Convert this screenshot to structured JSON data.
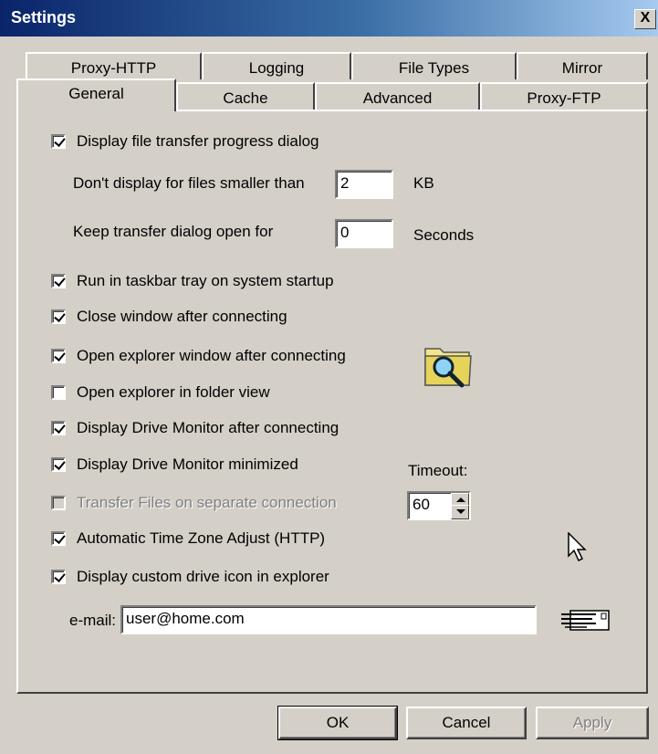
{
  "window": {
    "title": "Settings",
    "close_label": "X"
  },
  "tabs": {
    "back_row": [
      "Proxy-HTTP",
      "Logging",
      "File Types",
      "Mirror"
    ],
    "front_row": [
      "General",
      "Cache",
      "Advanced",
      "Proxy-FTP"
    ],
    "active": "General"
  },
  "general": {
    "display_progress": {
      "label": "Display file transfer progress dialog",
      "checked": true
    },
    "dont_display_label": "Don't display for files smaller than",
    "dont_display_value": "2",
    "dont_display_unit": "KB",
    "keep_open_label": "Keep transfer dialog open for",
    "keep_open_value": "0",
    "keep_open_unit": "Seconds",
    "run_tray": {
      "label": "Run in taskbar tray on system startup",
      "checked": true
    },
    "close_window": {
      "label": "Close window after connecting",
      "checked": true
    },
    "open_explorer": {
      "label": "Open explorer window after connecting",
      "checked": true
    },
    "folder_view": {
      "label": "Open explorer in folder view",
      "checked": false
    },
    "drive_monitor": {
      "label": "Display Drive Monitor after connecting",
      "checked": true
    },
    "drive_monitor_min": {
      "label": "Display Drive Monitor minimized",
      "checked": true
    },
    "separate_conn": {
      "label": "Transfer Files on separate connection",
      "checked": false,
      "disabled": true
    },
    "timezone": {
      "label": "Automatic Time Zone Adjust (HTTP)",
      "checked": true
    },
    "custom_icon": {
      "label": "Display custom drive icon in explorer",
      "checked": true
    },
    "timeout_label": "Timeout:",
    "timeout_value": "60",
    "email_label": "e-mail:",
    "email_value": "user@home.com"
  },
  "buttons": {
    "ok": "OK",
    "cancel": "Cancel",
    "apply": "Apply"
  },
  "colors": {
    "title_start": "#0a246a",
    "title_end": "#a6caf0",
    "face": "#d4d0c8"
  }
}
